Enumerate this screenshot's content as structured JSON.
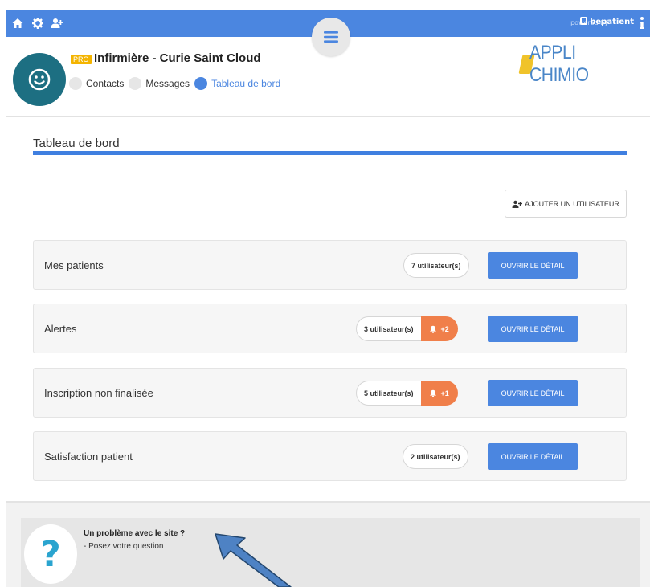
{
  "topbar": {
    "powered": "powered by",
    "brand": "bepatient",
    "colors": {
      "bar": "#4b86e0"
    },
    "icons": [
      "home-icon",
      "gear-icon",
      "add-user-icon",
      "info-icon"
    ]
  },
  "header": {
    "badge": "PRO",
    "title": "Infirmière - Curie Saint Cloud",
    "nav": [
      {
        "label": "Contacts",
        "active": false
      },
      {
        "label": "Messages",
        "active": false
      },
      {
        "label": "Tableau de bord",
        "active": true
      }
    ],
    "logo_text": "APPLI CHIMIO"
  },
  "dashboard": {
    "title": "Tableau de bord",
    "add_user_label": "AJOUTER UN UTILISATEUR",
    "rows": [
      {
        "label": "Mes patients",
        "count": "7 utilisateur(s)",
        "alert": null,
        "button": "OUVRIR LE DÉTAIL"
      },
      {
        "label": "Alertes",
        "count": "3 utilisateur(s)",
        "alert": "+2",
        "button": "OUVRIR LE DÉTAIL"
      },
      {
        "label": "Inscription non finalisée",
        "count": "5 utilisateur(s)",
        "alert": "+1",
        "button": "OUVRIR LE DÉTAIL"
      },
      {
        "label": "Satisfaction patient",
        "count": "2 utilisateur(s)",
        "alert": null,
        "button": "OUVRIR LE DÉTAIL"
      }
    ]
  },
  "help": {
    "icon": "?",
    "title": "Un problème avec le site ?",
    "subtitle": "- Posez votre question"
  }
}
